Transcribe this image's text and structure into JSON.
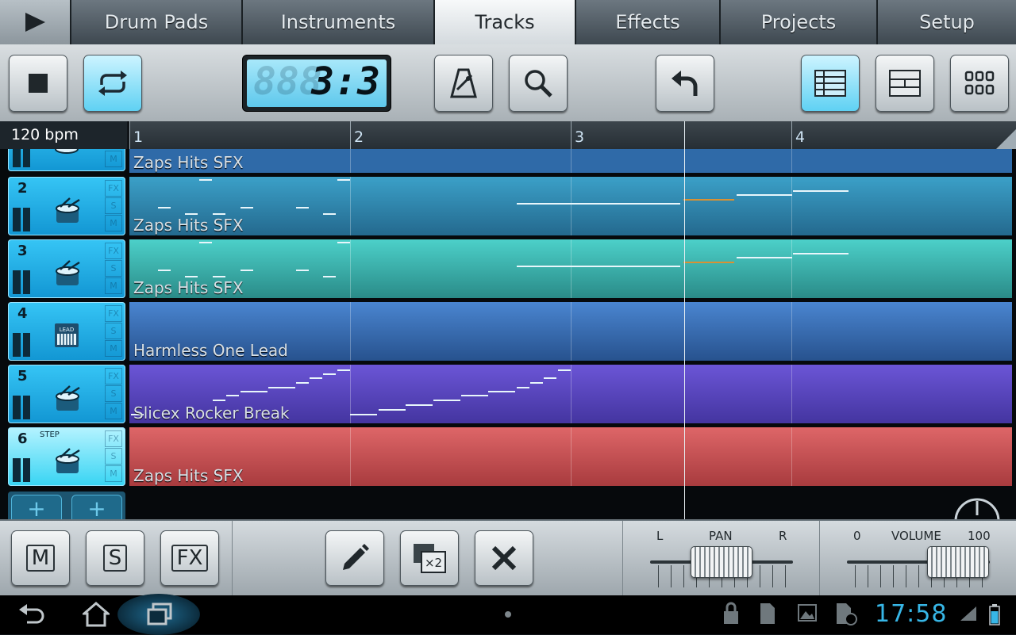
{
  "tabs": {
    "drum_pads": "Drum Pads",
    "instruments": "Instruments",
    "tracks": "Tracks",
    "effects": "Effects",
    "projects": "Projects",
    "setup": "Setup"
  },
  "transport": {
    "position_display": "3:3",
    "ghost_display": "888"
  },
  "tempo": {
    "label": "120 bpm"
  },
  "ruler": {
    "bars": [
      "1",
      "2",
      "3",
      "4"
    ]
  },
  "tracks": [
    {
      "number": "",
      "clip_name": "Zaps Hits SFX",
      "color": "#2f6aa8",
      "icon": "drum-icon"
    },
    {
      "number": "2",
      "clip_name": "Zaps Hits SFX",
      "color": "#2d86ad",
      "icon": "drum-icon"
    },
    {
      "number": "3",
      "clip_name": "Zaps Hits SFX",
      "color": "#33a9a5",
      "icon": "drum-icon"
    },
    {
      "number": "4",
      "clip_name": "Harmless One Lead",
      "color": "#3665b8",
      "icon": "keyboard-icon",
      "icon_text": "LEAD"
    },
    {
      "number": "5",
      "clip_name": "Slicex Rocker Break",
      "color": "#5b46c0",
      "icon": "drum-icon"
    },
    {
      "number": "6",
      "clip_name": "Zaps Hits SFX",
      "color": "#c54d4f",
      "icon": "drum-icon",
      "step_label": "STEP"
    }
  ],
  "flags": {
    "fx": "FX",
    "s": "S",
    "m": "M"
  },
  "add": {
    "plus": "+"
  },
  "bottom": {
    "mute": "M",
    "solo": "S",
    "fx": "FX",
    "duplicate": "×2"
  },
  "pan": {
    "left": "L",
    "title": "PAN",
    "right": "R",
    "value": 0.5
  },
  "volume": {
    "min": "0",
    "title": "VOLUME",
    "max": "100",
    "value": 0.78
  },
  "status": {
    "clock": "17:58"
  },
  "colors": {
    "accent": "#37b6e6",
    "selected_button": "#5fd1f3"
  }
}
